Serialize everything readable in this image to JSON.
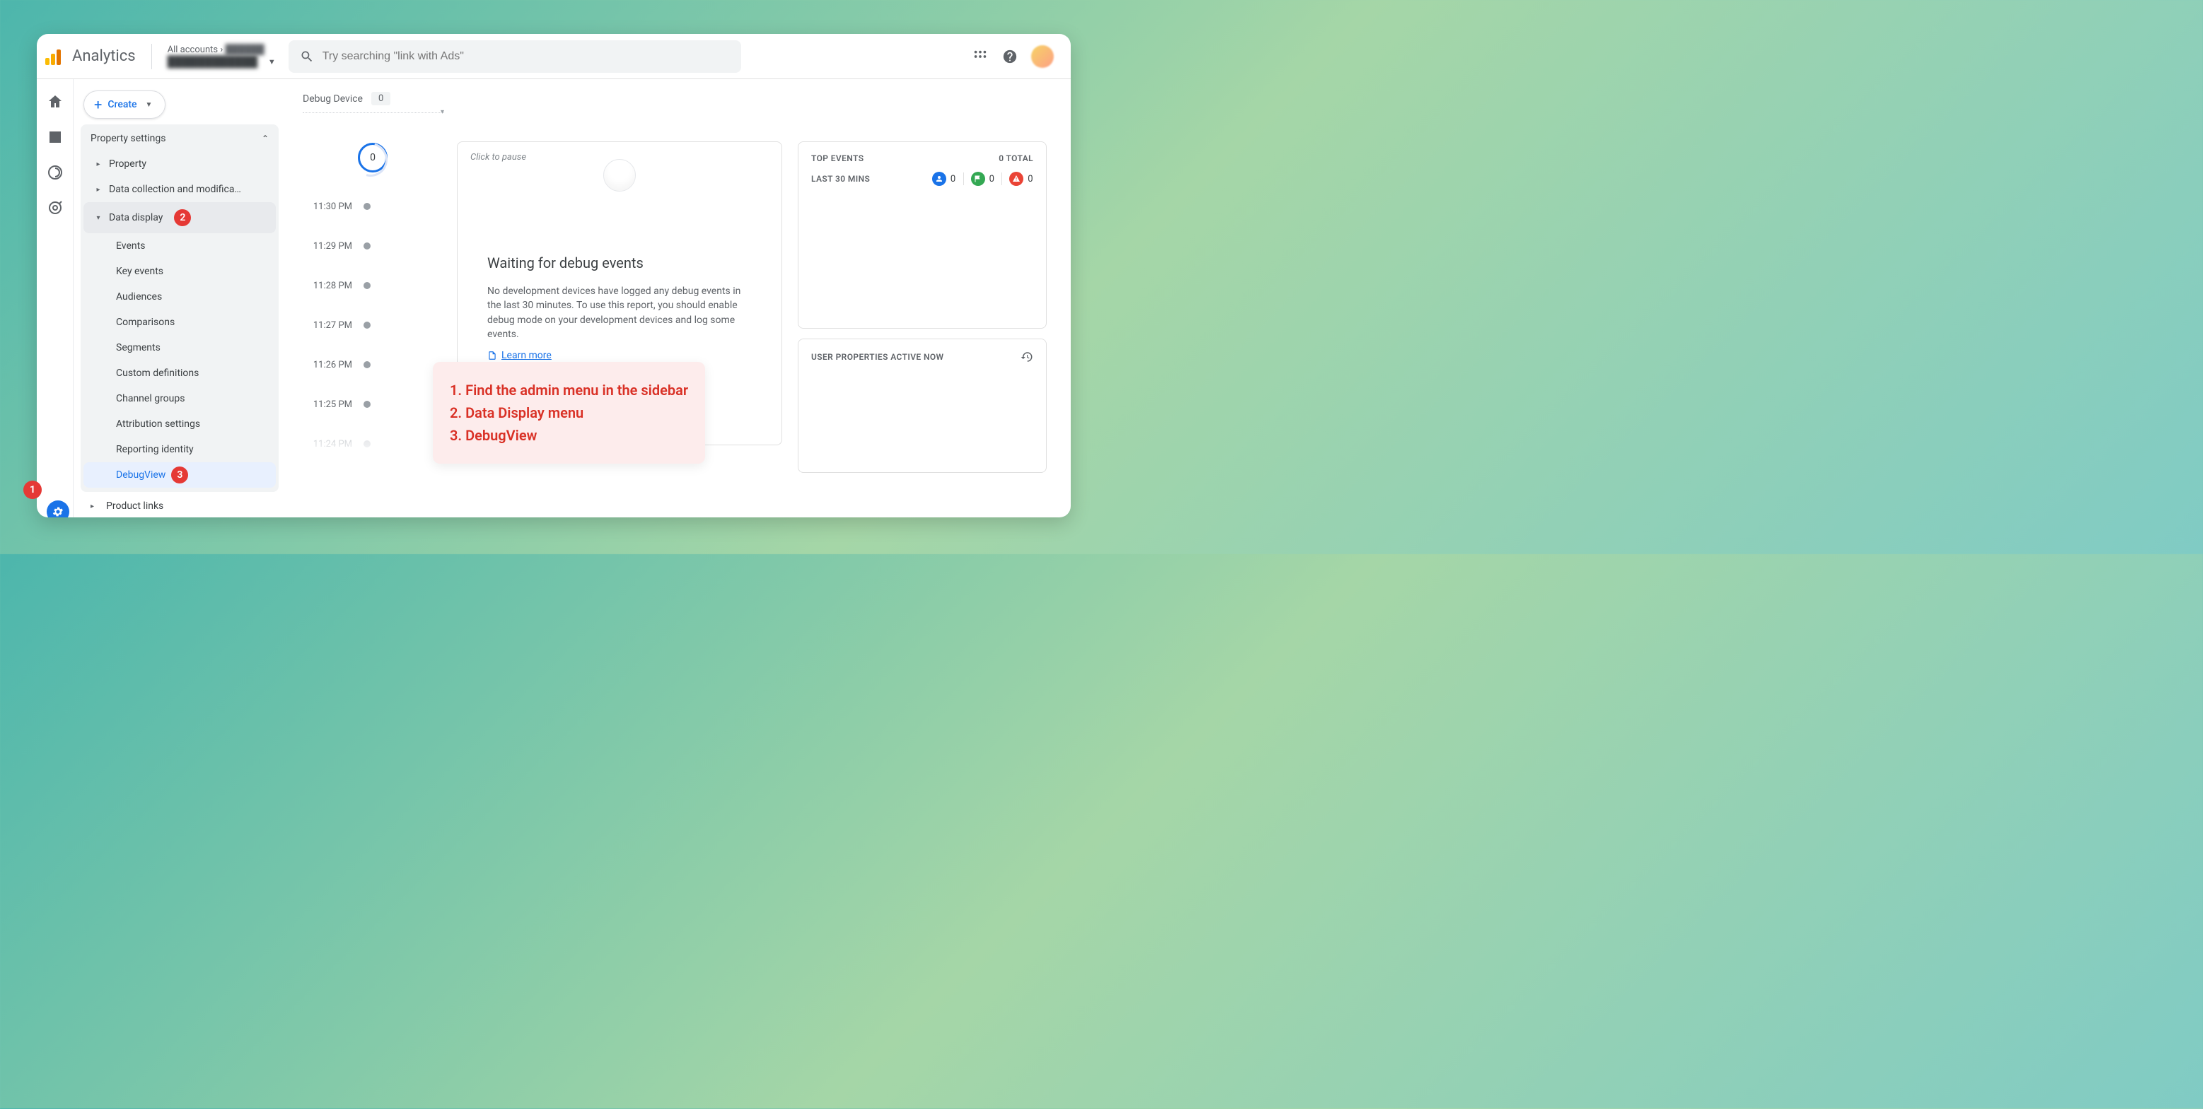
{
  "header": {
    "product": "Analytics",
    "account_line1": "All accounts",
    "search_placeholder": "Try searching \"link with Ads\""
  },
  "create_label": "Create",
  "sidebar": {
    "section": "Property settings",
    "items": [
      {
        "label": "Property"
      },
      {
        "label": "Data collection and modifica…"
      },
      {
        "label": "Data display"
      }
    ],
    "subitems": [
      "Events",
      "Key events",
      "Audiences",
      "Comparisons",
      "Segments",
      "Custom definitions",
      "Channel groups",
      "Attribution settings",
      "Reporting identity",
      "DebugView"
    ],
    "bottom": "Product links"
  },
  "badges": {
    "s2": "2",
    "s3": "3",
    "ext1": "1"
  },
  "debug_device": {
    "label": "Debug Device",
    "value": "0"
  },
  "timeline": {
    "top_value": "0",
    "times": [
      "11:30 PM",
      "11:29 PM",
      "11:28 PM",
      "11:27 PM",
      "11:26 PM",
      "11:25 PM",
      "11:24 PM"
    ]
  },
  "center": {
    "click_to_pause": "Click to pause",
    "waiting_title": "Waiting for debug events",
    "waiting_desc": "No development devices have logged any debug events in the last 30 minutes. To use this report, you should enable debug mode on your development devices and log some events.",
    "learn_more": "Learn more"
  },
  "right": {
    "top_events": "TOP EVENTS",
    "total": "0 TOTAL",
    "last30": "LAST 30 MINS",
    "c1": "0",
    "c2": "0",
    "c3": "0",
    "user_props": "USER PROPERTIES ACTIVE NOW"
  },
  "overlay": {
    "s1": "1. Find the admin menu in the sidebar",
    "s2": "2. Data Display menu",
    "s3": "3. DebugView"
  }
}
